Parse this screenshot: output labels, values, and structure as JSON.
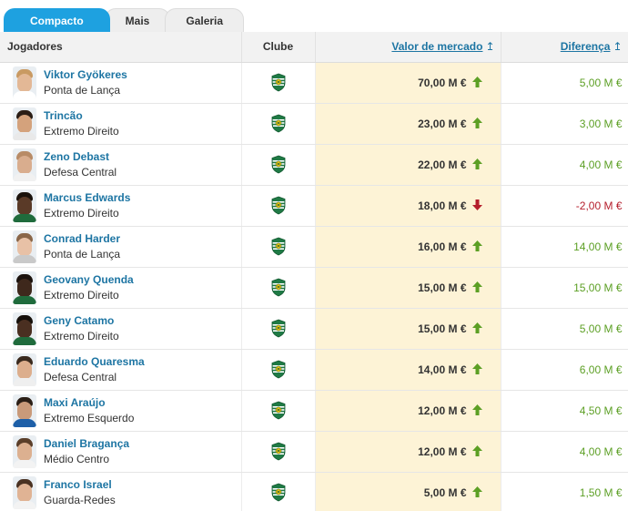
{
  "tabs": [
    {
      "label": "Compacto",
      "active": true
    },
    {
      "label": "Mais",
      "active": false
    },
    {
      "label": "Galeria",
      "active": false
    }
  ],
  "headers": {
    "player": "Jogadores",
    "club": "Clube",
    "value": "Valor de mercado",
    "diff": "Diferença",
    "sort_icon": "↥"
  },
  "club_icon": "sporting-crest-icon",
  "colors": {
    "accent": "#1ea1e0",
    "link": "#1d75a3",
    "positive": "#5c9f24",
    "negative": "#b51e2c",
    "value_bg": "#fdf3d6"
  },
  "rows": [
    {
      "name": "Viktor Gyökeres",
      "position": "Ponta de Lança",
      "value": "70,00 M €",
      "trend": "up",
      "diff": "5,00 M €",
      "skin": "#e3b896",
      "hair": "#c99a62",
      "shirt": "#ffffff"
    },
    {
      "name": "Trincão",
      "position": "Extremo Direito",
      "value": "23,00 M €",
      "trend": "up",
      "diff": "3,00 M €",
      "skin": "#d4a27c",
      "hair": "#2a1d15",
      "shirt": "#e9e9e9"
    },
    {
      "name": "Zeno Debast",
      "position": "Defesa Central",
      "value": "22,00 M €",
      "trend": "up",
      "diff": "4,00 M €",
      "skin": "#d9ad8e",
      "hair": "#b88b66",
      "shirt": "#f1f1f1"
    },
    {
      "name": "Marcus Edwards",
      "position": "Extremo Direito",
      "value": "18,00 M €",
      "trend": "down",
      "diff": "-2,00 M €",
      "skin": "#5a3a27",
      "hair": "#1a120c",
      "shirt": "#1f6b3c"
    },
    {
      "name": "Conrad Harder",
      "position": "Ponta de Lança",
      "value": "16,00 M €",
      "trend": "up",
      "diff": "14,00 M €",
      "skin": "#e8c1a6",
      "hair": "#8a6648",
      "shirt": "#c9c9c9"
    },
    {
      "name": "Geovany Quenda",
      "position": "Extremo Direito",
      "value": "15,00 M €",
      "trend": "up",
      "diff": "15,00 M €",
      "skin": "#3e281c",
      "hair": "#1b120d",
      "shirt": "#1f6b3c"
    },
    {
      "name": "Geny Catamo",
      "position": "Extremo Direito",
      "value": "15,00 M €",
      "trend": "up",
      "diff": "5,00 M €",
      "skin": "#4a2f21",
      "hair": "#16100b",
      "shirt": "#1f6b3c"
    },
    {
      "name": "Eduardo Quaresma",
      "position": "Defesa Central",
      "value": "14,00 M €",
      "trend": "up",
      "diff": "6,00 M €",
      "skin": "#dcae8d",
      "hair": "#3a2a1e",
      "shirt": "#efefef"
    },
    {
      "name": "Maxi Araújo",
      "position": "Extremo Esquerdo",
      "value": "12,00 M €",
      "trend": "up",
      "diff": "4,50 M €",
      "skin": "#c99a7a",
      "hair": "#2b1f17",
      "shirt": "#1d5fa8"
    },
    {
      "name": "Daniel Bragança",
      "position": "Médio Centro",
      "value": "12,00 M €",
      "trend": "up",
      "diff": "4,00 M €",
      "skin": "#dcb090",
      "hair": "#5b3f2a",
      "shirt": "#f3f3f3"
    },
    {
      "name": "Franco Israel",
      "position": "Guarda-Redes",
      "value": "5,00 M €",
      "trend": "up",
      "diff": "1,50 M €",
      "skin": "#e0b394",
      "hair": "#4a3222",
      "shirt": "#f3f3f3"
    }
  ]
}
